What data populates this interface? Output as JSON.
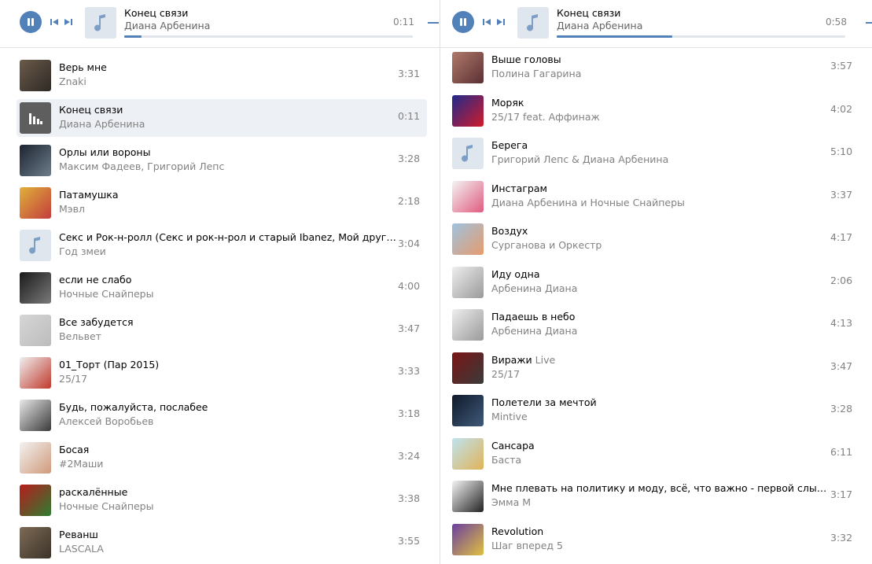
{
  "colors": {
    "accent": "#5181b8",
    "text": "#000000",
    "secondary": "#828282",
    "active_row": "#edf0f5"
  },
  "left_player": {
    "title": "Конец связи",
    "artist": "Диана Арбенина",
    "time": "0:11",
    "progress_fraction": 0.06
  },
  "right_player": {
    "title": "Конец связи",
    "artist": "Диана Арбенина",
    "time": "0:58",
    "progress_fraction": 0.4
  },
  "left_tracks": [
    {
      "title": "Верь мне",
      "subtitle": "",
      "artist": "Znaki",
      "duration": "3:31",
      "cover": "img",
      "palette": [
        "#6b5a4a",
        "#2f2a26"
      ]
    },
    {
      "title": "Конец связи",
      "subtitle": "",
      "artist": "Диана Арбенина",
      "duration": "0:11",
      "cover": "playing",
      "active": true
    },
    {
      "title": "Орлы или вороны",
      "subtitle": "",
      "artist": "Максим Фадеев, Григорий Лепс",
      "duration": "3:28",
      "cover": "img",
      "palette": [
        "#1c2430",
        "#6e7d8c"
      ]
    },
    {
      "title": "Патамушка",
      "subtitle": "",
      "artist": "Мэвл",
      "duration": "2:18",
      "cover": "img",
      "palette": [
        "#e0b03a",
        "#c33d3d"
      ]
    },
    {
      "title": "Секс и Рок-н-ролл (Секс и рок-н-рол и старый Ibanez, Мой друг в...",
      "subtitle": "",
      "artist": "Год змеи",
      "duration": "3:04",
      "cover": "note"
    },
    {
      "title": "если не слабо",
      "subtitle": "",
      "artist": "Ночные Снайперы",
      "duration": "4:00",
      "cover": "img",
      "palette": [
        "#1a1a1a",
        "#7a7a7a"
      ]
    },
    {
      "title": "Все забудется",
      "subtitle": "",
      "artist": "Вельвет",
      "duration": "3:47",
      "cover": "img",
      "palette": [
        "#d6d6d6",
        "#bcbcbc"
      ]
    },
    {
      "title": "01_Торт (Пар 2015)",
      "subtitle": "",
      "artist": "25/17",
      "duration": "3:33",
      "cover": "img",
      "palette": [
        "#f0f0f0",
        "#c0392b"
      ]
    },
    {
      "title": "Будь, пожалуйста, послабее",
      "subtitle": "",
      "artist": "Алексей Воробьев",
      "duration": "3:18",
      "cover": "img",
      "palette": [
        "#e8e8e8",
        "#3a3a3a"
      ]
    },
    {
      "title": "Босая",
      "subtitle": "",
      "artist": "#2Маши",
      "duration": "3:24",
      "cover": "img",
      "palette": [
        "#f2f2f2",
        "#d19a7a"
      ]
    },
    {
      "title": "раскалённые",
      "subtitle": "",
      "artist": "Ночные Снайперы",
      "duration": "3:38",
      "cover": "img",
      "palette": [
        "#b71c1c",
        "#2e7d32"
      ]
    },
    {
      "title": "Реванш",
      "subtitle": "",
      "artist": "LASCALA",
      "duration": "3:55",
      "cover": "img",
      "palette": [
        "#7d6a55",
        "#3b3329"
      ]
    }
  ],
  "right_tracks": [
    {
      "title": "Выше головы",
      "subtitle": "",
      "artist": "Полина Гагарина",
      "duration": "3:57",
      "cover": "img",
      "palette": [
        "#b07a6a",
        "#5a2f33"
      ]
    },
    {
      "title": "Моряк",
      "subtitle": "",
      "artist": "25/17 feat. Аффинаж",
      "duration": "4:02",
      "cover": "img",
      "palette": [
        "#1f2a8c",
        "#d11b2a"
      ]
    },
    {
      "title": "Берега",
      "subtitle": "",
      "artist": "Григорий Лепс & Диана Арбенина",
      "duration": "5:10",
      "cover": "note"
    },
    {
      "title": "Инстаграм",
      "subtitle": "",
      "artist": "Диана Арбенина и Ночные Снайперы",
      "duration": "3:37",
      "cover": "img",
      "palette": [
        "#f4f4f4",
        "#e05b7f"
      ]
    },
    {
      "title": "Воздух",
      "subtitle": "",
      "artist": "Сурганова и Оркестр",
      "duration": "4:17",
      "cover": "img",
      "palette": [
        "#9ec3e0",
        "#e79b6c"
      ]
    },
    {
      "title": "Иду одна",
      "subtitle": "",
      "artist": "Арбенина Диана",
      "duration": "2:06",
      "cover": "img",
      "palette": [
        "#eeeeee",
        "#9a9a9a"
      ]
    },
    {
      "title": "Падаешь в небо",
      "subtitle": "",
      "artist": "Арбенина Диана",
      "duration": "4:13",
      "cover": "img",
      "palette": [
        "#eeeeee",
        "#9a9a9a"
      ]
    },
    {
      "title": "Виражи",
      "subtitle": "Live",
      "artist": "25/17",
      "duration": "3:47",
      "cover": "img",
      "palette": [
        "#7b1515",
        "#3a3a3a"
      ]
    },
    {
      "title": "Полетели за мечтой",
      "subtitle": "",
      "artist": "Mintive",
      "duration": "3:28",
      "cover": "img",
      "palette": [
        "#0f1a2a",
        "#405a7a"
      ]
    },
    {
      "title": "Сансара",
      "subtitle": "",
      "artist": "Баста",
      "duration": "6:11",
      "cover": "img",
      "palette": [
        "#bfe3f0",
        "#e0b357"
      ]
    },
    {
      "title": "Мне плевать на политику и моду, всё, что важно - первой слыша...",
      "subtitle": "",
      "artist": "Эмма М",
      "duration": "3:17",
      "cover": "img",
      "palette": [
        "#f5f5f5",
        "#222222"
      ]
    },
    {
      "title": "Revolution",
      "subtitle": "",
      "artist": "Шаг вперед 5",
      "duration": "3:32",
      "cover": "img",
      "palette": [
        "#6b3fa0",
        "#e0c040"
      ]
    }
  ]
}
